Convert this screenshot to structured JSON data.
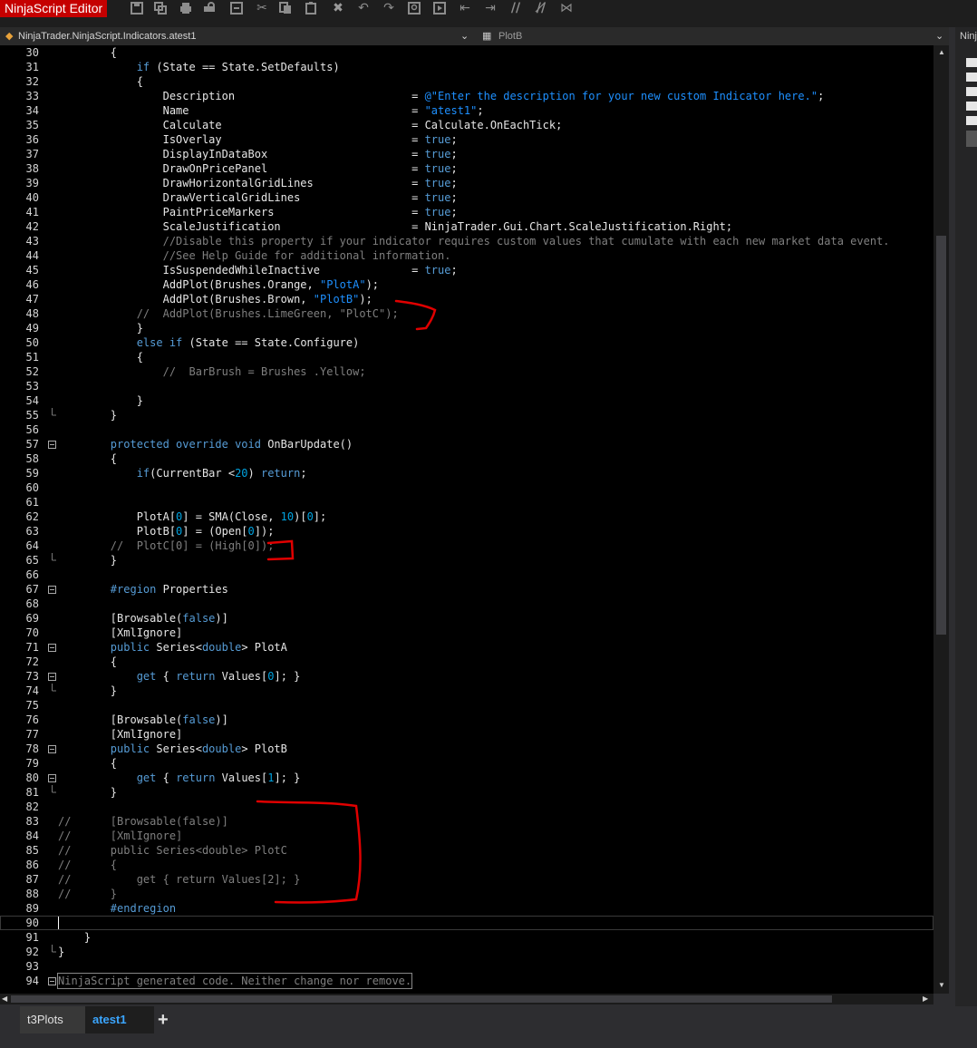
{
  "app": {
    "title": "NinjaScript Editor"
  },
  "toolbar": {
    "buttons": [
      "save",
      "save-all",
      "print",
      "print-preview",
      "compile",
      "cut",
      "copy",
      "paste",
      "delete",
      "undo",
      "redo",
      "find",
      "run",
      "indent-decrease",
      "indent-increase",
      "comment",
      "uncomment",
      "visual-studio"
    ]
  },
  "nav": {
    "class_dropdown": "NinjaTrader.NinjaScript.Indicators.atest1",
    "member_dropdown": "PlotB",
    "right_panel_title": "Ninj"
  },
  "editor": {
    "lines": [
      {
        "num": "30",
        "fold": "",
        "segs": [
          [
            "w",
            "        {"
          ]
        ]
      },
      {
        "num": "31",
        "fold": "",
        "segs": [
          [
            "w",
            "            "
          ],
          [
            "k",
            "if"
          ],
          [
            "w",
            " (State == State.SetDefaults)"
          ]
        ]
      },
      {
        "num": "32",
        "fold": "",
        "segs": [
          [
            "w",
            "            {"
          ]
        ]
      },
      {
        "num": "33",
        "fold": "",
        "segs": [
          [
            "w",
            "                Description                           = "
          ],
          [
            "s",
            "@\"Enter the description for your new custom Indicator here.\""
          ],
          [
            "w",
            ";"
          ]
        ]
      },
      {
        "num": "34",
        "fold": "",
        "segs": [
          [
            "w",
            "                Name                                  = "
          ],
          [
            "s",
            "\"atest1\""
          ],
          [
            "w",
            ";"
          ]
        ]
      },
      {
        "num": "35",
        "fold": "",
        "segs": [
          [
            "w",
            "                Calculate                             = Calculate.OnEachTick;"
          ]
        ]
      },
      {
        "num": "36",
        "fold": "",
        "segs": [
          [
            "w",
            "                IsOverlay                             = "
          ],
          [
            "k",
            "true"
          ],
          [
            "w",
            ";"
          ]
        ]
      },
      {
        "num": "37",
        "fold": "",
        "segs": [
          [
            "w",
            "                DisplayInDataBox                      = "
          ],
          [
            "k",
            "true"
          ],
          [
            "w",
            ";"
          ]
        ]
      },
      {
        "num": "38",
        "fold": "",
        "segs": [
          [
            "w",
            "                DrawOnPricePanel                      = "
          ],
          [
            "k",
            "true"
          ],
          [
            "w",
            ";"
          ]
        ]
      },
      {
        "num": "39",
        "fold": "",
        "segs": [
          [
            "w",
            "                DrawHorizontalGridLines               = "
          ],
          [
            "k",
            "true"
          ],
          [
            "w",
            ";"
          ]
        ]
      },
      {
        "num": "40",
        "fold": "",
        "segs": [
          [
            "w",
            "                DrawVerticalGridLines                 = "
          ],
          [
            "k",
            "true"
          ],
          [
            "w",
            ";"
          ]
        ]
      },
      {
        "num": "41",
        "fold": "",
        "segs": [
          [
            "w",
            "                PaintPriceMarkers                     = "
          ],
          [
            "k",
            "true"
          ],
          [
            "w",
            ";"
          ]
        ]
      },
      {
        "num": "42",
        "fold": "",
        "segs": [
          [
            "w",
            "                ScaleJustification                    = NinjaTrader.Gui.Chart.ScaleJustification.Right;"
          ]
        ]
      },
      {
        "num": "43",
        "fold": "",
        "segs": [
          [
            "w",
            "                "
          ],
          [
            "c",
            "//Disable this property if your indicator requires custom values that cumulate with each new market data event."
          ]
        ]
      },
      {
        "num": "44",
        "fold": "",
        "segs": [
          [
            "w",
            "                "
          ],
          [
            "c",
            "//See Help Guide for additional information."
          ]
        ]
      },
      {
        "num": "45",
        "fold": "",
        "segs": [
          [
            "w",
            "                IsSuspendedWhileInactive              = "
          ],
          [
            "k",
            "true"
          ],
          [
            "w",
            ";"
          ]
        ]
      },
      {
        "num": "46",
        "fold": "",
        "segs": [
          [
            "w",
            "                AddPlot(Brushes.Orange, "
          ],
          [
            "s",
            "\"PlotA\""
          ],
          [
            "w",
            ");"
          ]
        ]
      },
      {
        "num": "47",
        "fold": "",
        "segs": [
          [
            "w",
            "                AddPlot(Brushes.Brown, "
          ],
          [
            "s",
            "\"PlotB\""
          ],
          [
            "w",
            ");"
          ]
        ]
      },
      {
        "num": "48",
        "fold": "",
        "segs": [
          [
            "c",
            "            //  AddPlot(Brushes.LimeGreen, \"PlotC\");"
          ]
        ]
      },
      {
        "num": "49",
        "fold": "",
        "segs": [
          [
            "w",
            "            }"
          ]
        ]
      },
      {
        "num": "50",
        "fold": "",
        "segs": [
          [
            "w",
            "            "
          ],
          [
            "k",
            "else if"
          ],
          [
            "w",
            " (State == State.Configure)"
          ]
        ]
      },
      {
        "num": "51",
        "fold": "",
        "segs": [
          [
            "w",
            "            {"
          ]
        ]
      },
      {
        "num": "52",
        "fold": "",
        "segs": [
          [
            "w",
            "                "
          ],
          [
            "c",
            "//  BarBrush = Brushes .Yellow;"
          ]
        ]
      },
      {
        "num": "53",
        "fold": "",
        "segs": []
      },
      {
        "num": "54",
        "fold": "",
        "segs": [
          [
            "w",
            "            }"
          ]
        ]
      },
      {
        "num": "55",
        "fold": "end",
        "segs": [
          [
            "w",
            "        }"
          ]
        ]
      },
      {
        "num": "56",
        "fold": "",
        "segs": []
      },
      {
        "num": "57",
        "fold": "box",
        "segs": [
          [
            "w",
            "        "
          ],
          [
            "k",
            "protected override void"
          ],
          [
            "w",
            " OnBarUpdate()"
          ]
        ]
      },
      {
        "num": "58",
        "fold": "",
        "segs": [
          [
            "w",
            "        {"
          ]
        ]
      },
      {
        "num": "59",
        "fold": "",
        "segs": [
          [
            "w",
            "            "
          ],
          [
            "k",
            "if"
          ],
          [
            "w",
            "(CurrentBar <"
          ],
          [
            "n",
            "20"
          ],
          [
            "w",
            ") "
          ],
          [
            "k",
            "return"
          ],
          [
            "w",
            ";"
          ]
        ]
      },
      {
        "num": "60",
        "fold": "",
        "segs": []
      },
      {
        "num": "61",
        "fold": "",
        "segs": []
      },
      {
        "num": "62",
        "fold": "",
        "segs": [
          [
            "w",
            "            PlotA["
          ],
          [
            "n",
            "0"
          ],
          [
            "w",
            "] = SMA(Close, "
          ],
          [
            "n",
            "10"
          ],
          [
            "w",
            ")["
          ],
          [
            "n",
            "0"
          ],
          [
            "w",
            "];"
          ]
        ]
      },
      {
        "num": "63",
        "fold": "",
        "segs": [
          [
            "w",
            "            PlotB["
          ],
          [
            "n",
            "0"
          ],
          [
            "w",
            "] = (Open["
          ],
          [
            "n",
            "0"
          ],
          [
            "w",
            "]);"
          ]
        ]
      },
      {
        "num": "64",
        "fold": "",
        "segs": [
          [
            "c",
            "        //  PlotC[0] = (High[0]);"
          ]
        ]
      },
      {
        "num": "65",
        "fold": "end",
        "segs": [
          [
            "w",
            "        }"
          ]
        ]
      },
      {
        "num": "66",
        "fold": "",
        "segs": []
      },
      {
        "num": "67",
        "fold": "box",
        "segs": [
          [
            "w",
            "        "
          ],
          [
            "k",
            "#region"
          ],
          [
            "w",
            " Properties"
          ]
        ]
      },
      {
        "num": "68",
        "fold": "",
        "segs": []
      },
      {
        "num": "69",
        "fold": "",
        "segs": [
          [
            "w",
            "        [Browsable("
          ],
          [
            "k",
            "false"
          ],
          [
            "w",
            ")]"
          ]
        ]
      },
      {
        "num": "70",
        "fold": "",
        "segs": [
          [
            "w",
            "        [XmlIgnore]"
          ]
        ]
      },
      {
        "num": "71",
        "fold": "box",
        "segs": [
          [
            "w",
            "        "
          ],
          [
            "k",
            "public"
          ],
          [
            "w",
            " Series<"
          ],
          [
            "k",
            "double"
          ],
          [
            "w",
            "> PlotA"
          ]
        ]
      },
      {
        "num": "72",
        "fold": "",
        "segs": [
          [
            "w",
            "        {"
          ]
        ]
      },
      {
        "num": "73",
        "fold": "box",
        "segs": [
          [
            "w",
            "            "
          ],
          [
            "k",
            "get"
          ],
          [
            "w",
            " { "
          ],
          [
            "k",
            "return"
          ],
          [
            "w",
            " Values["
          ],
          [
            "n",
            "0"
          ],
          [
            "w",
            "]; }"
          ]
        ]
      },
      {
        "num": "74",
        "fold": "end",
        "segs": [
          [
            "w",
            "        }"
          ]
        ]
      },
      {
        "num": "75",
        "fold": "",
        "segs": []
      },
      {
        "num": "76",
        "fold": "",
        "segs": [
          [
            "w",
            "        [Browsable("
          ],
          [
            "k",
            "false"
          ],
          [
            "w",
            ")]"
          ]
        ]
      },
      {
        "num": "77",
        "fold": "",
        "segs": [
          [
            "w",
            "        [XmlIgnore]"
          ]
        ]
      },
      {
        "num": "78",
        "fold": "box",
        "segs": [
          [
            "w",
            "        "
          ],
          [
            "k",
            "public"
          ],
          [
            "w",
            " Series<"
          ],
          [
            "k",
            "double"
          ],
          [
            "w",
            "> PlotB"
          ]
        ]
      },
      {
        "num": "79",
        "fold": "",
        "segs": [
          [
            "w",
            "        {"
          ]
        ]
      },
      {
        "num": "80",
        "fold": "box",
        "segs": [
          [
            "w",
            "            "
          ],
          [
            "k",
            "get"
          ],
          [
            "w",
            " { "
          ],
          [
            "k",
            "return"
          ],
          [
            "w",
            " Values["
          ],
          [
            "n",
            "1"
          ],
          [
            "w",
            "]; }"
          ]
        ]
      },
      {
        "num": "81",
        "fold": "end",
        "segs": [
          [
            "w",
            "        }"
          ]
        ]
      },
      {
        "num": "82",
        "fold": "",
        "segs": []
      },
      {
        "num": "83",
        "fold": "",
        "segs": [
          [
            "c",
            "//      [Browsable(false)]"
          ]
        ]
      },
      {
        "num": "84",
        "fold": "",
        "segs": [
          [
            "c",
            "//      [XmlIgnore]"
          ]
        ]
      },
      {
        "num": "85",
        "fold": "",
        "segs": [
          [
            "c",
            "//      public Series<double> PlotC"
          ]
        ]
      },
      {
        "num": "86",
        "fold": "",
        "segs": [
          [
            "c",
            "//      {"
          ]
        ]
      },
      {
        "num": "87",
        "fold": "",
        "segs": [
          [
            "c",
            "//          get { return Values[2]; }"
          ]
        ]
      },
      {
        "num": "88",
        "fold": "",
        "segs": [
          [
            "c",
            "//      }"
          ]
        ]
      },
      {
        "num": "89",
        "fold": "",
        "segs": [
          [
            "w",
            "        "
          ],
          [
            "k",
            "#endregion"
          ]
        ]
      },
      {
        "num": "90",
        "fold": "",
        "segs": []
      },
      {
        "num": "91",
        "fold": "",
        "segs": [
          [
            "w",
            "    }"
          ]
        ]
      },
      {
        "num": "92",
        "fold": "end",
        "segs": [
          [
            "w",
            "}"
          ]
        ]
      },
      {
        "num": "93",
        "fold": "",
        "segs": []
      },
      {
        "num": "94",
        "fold": "box",
        "segs": [
          [
            "c",
            "NinjaScript generated code. Neither change nor remove."
          ]
        ]
      }
    ]
  },
  "tabs": [
    {
      "label": "t3Plots"
    },
    {
      "label": "atest1"
    }
  ],
  "tab_add": "+",
  "colors": {
    "title_bg": "#c50000",
    "keyword": "#569cd6",
    "string": "#1e90ff",
    "comment": "#7f7f7f",
    "number": "#00a3e0",
    "annotation": "#e00000"
  }
}
